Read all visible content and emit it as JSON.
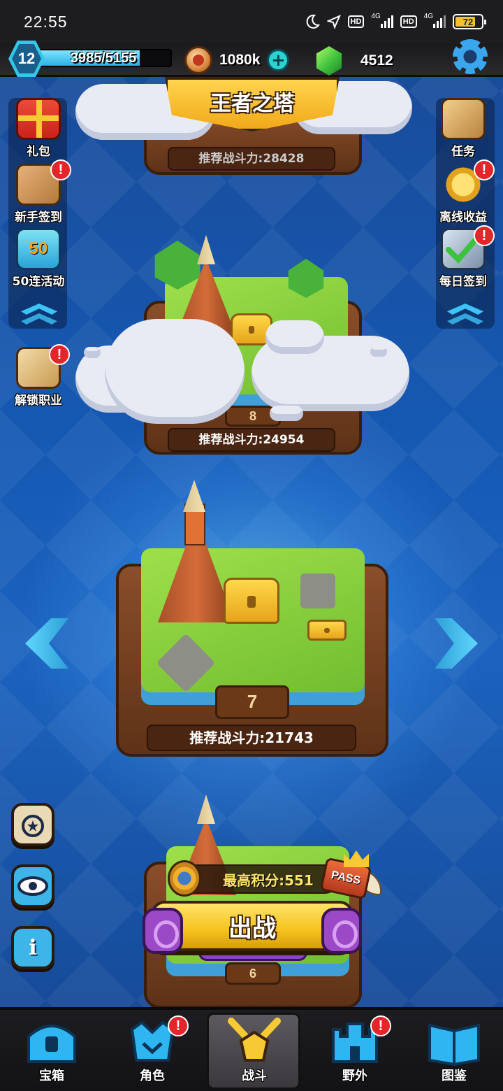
{
  "status_bar": {
    "time": "22:55",
    "net_1": "4G",
    "net_2": "4G",
    "hd_1": "HD",
    "hd_2": "HD",
    "battery": "72"
  },
  "resources": {
    "level": "12",
    "xp_text": "3985/5155",
    "xp_fraction": 0.773,
    "coins": "1080k",
    "gems": "4512"
  },
  "title": "王者之塔",
  "left_menu": {
    "gift": "礼包",
    "newbie_checkin": "新手签到",
    "event_50": "50连活动",
    "event_50_badge": "50",
    "unlock_class": "解锁职业"
  },
  "right_menu": {
    "tasks": "任务",
    "offline_earnings": "离线收益",
    "daily_checkin": "每日签到"
  },
  "alert_mark": "!",
  "stages": {
    "top_power": "推荐战斗力:28428",
    "upper_power": "推荐战斗力:24954",
    "upper_number": "8",
    "current_power": "推荐战斗力:21743",
    "current_number": "7",
    "lower_number": "6"
  },
  "bottom_panel": {
    "high_score": "最高积分:551",
    "pass": "PASS",
    "battle": "出战",
    "info_glyph": "i"
  },
  "nav": {
    "chest": "宝箱",
    "character": "角色",
    "battle": "战斗",
    "wild": "野外",
    "codex": "图鉴"
  },
  "colors": {
    "background": "#1559b3",
    "accent_gold": "#f5c21c",
    "accent_cyan": "#3ec3f5",
    "alert_red": "#e3262a"
  }
}
